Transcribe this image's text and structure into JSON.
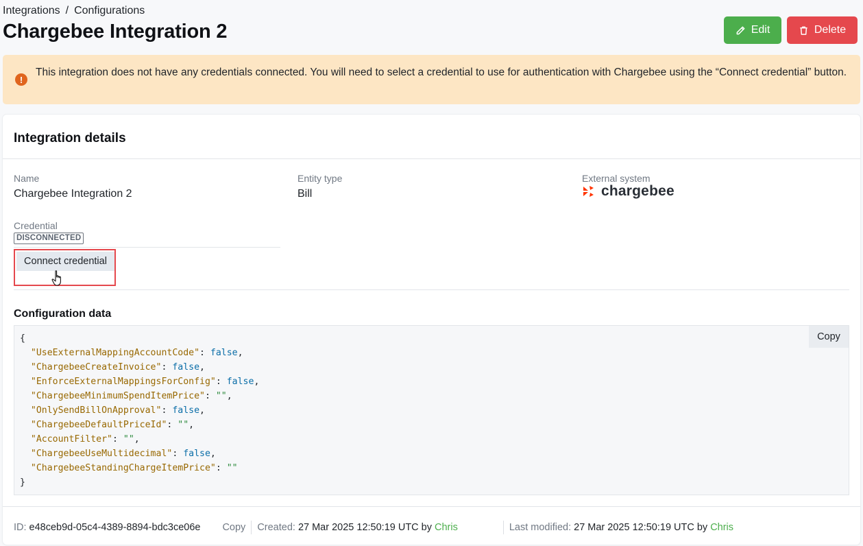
{
  "breadcrumb": {
    "items": [
      "Integrations",
      "Configurations"
    ],
    "separator": "/"
  },
  "page_title": "Chargebee Integration 2",
  "actions": {
    "edit_label": "Edit",
    "delete_label": "Delete"
  },
  "alert": {
    "icon": "exclamation-icon",
    "text": "This integration does not have any credentials connected. You will need to select a credential to use for authentication with Chargebee using the “Connect credential” button."
  },
  "details": {
    "title": "Integration details",
    "name_label": "Name",
    "name_value": "Chargebee Integration 2",
    "entity_label": "Entity type",
    "entity_value": "Bill",
    "external_label": "External system",
    "external_logo_text": "chargebee",
    "credential_label": "Credential",
    "credential_status": "DISCONNECTED",
    "connect_label": "Connect credential"
  },
  "config": {
    "title": "Configuration data",
    "copy_label": "Copy",
    "open_brace": "{",
    "close_brace": "}",
    "entries": [
      {
        "key": "\"UseExternalMappingAccountCode\"",
        "value": "false",
        "type": "bool"
      },
      {
        "key": "\"ChargebeeCreateInvoice\"",
        "value": "false",
        "type": "bool"
      },
      {
        "key": "\"EnforceExternalMappingsForConfig\"",
        "value": "false",
        "type": "bool"
      },
      {
        "key": "\"ChargebeeMinimumSpendItemPrice\"",
        "value": "\"\"",
        "type": "string"
      },
      {
        "key": "\"OnlySendBillOnApproval\"",
        "value": "false",
        "type": "bool"
      },
      {
        "key": "\"ChargebeeDefaultPriceId\"",
        "value": "\"\"",
        "type": "string"
      },
      {
        "key": "\"AccountFilter\"",
        "value": "\"\"",
        "type": "string"
      },
      {
        "key": "\"ChargebeeUseMultidecimal\"",
        "value": "false",
        "type": "bool"
      },
      {
        "key": "\"ChargebeeStandingChargeItemPrice\"",
        "value": "\"\"",
        "type": "string"
      }
    ]
  },
  "footer": {
    "id_label": "ID:",
    "id_value": "e48ceb9d-05c4-4389-8894-bdc3ce06e",
    "copy_label": "Copy",
    "created_label": "Created:",
    "created_value": "27 Mar 2025 12:50:19 UTC by",
    "created_by": "Chris",
    "modified_label": "Last modified:",
    "modified_value": "27 Mar 2025 12:50:19 UTC by",
    "modified_by": "Chris"
  },
  "colors": {
    "edit": "#4cae4c",
    "delete": "#e5484d",
    "alert_bg": "#fde6c4",
    "alert_icon": "#e0651e",
    "chargebee_orange": "#ff3300",
    "highlight": "#e5484d"
  }
}
